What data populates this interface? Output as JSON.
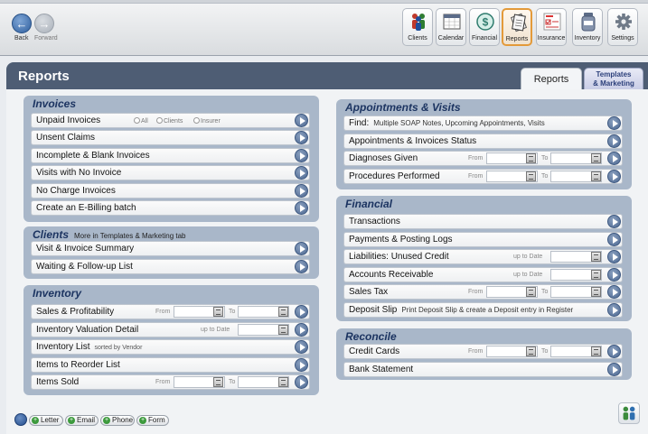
{
  "nav": {
    "back": "Back",
    "forward": "Forward"
  },
  "toolbar": [
    {
      "name": "clients",
      "label": "Clients",
      "icon": "people-icon"
    },
    {
      "name": "calendar",
      "label": "Calendar",
      "icon": "calendar-icon"
    },
    {
      "name": "financial",
      "label": "Financial",
      "icon": "dollar-icon"
    },
    {
      "name": "reports",
      "label": "Reports",
      "icon": "reports-icon",
      "active": true
    },
    {
      "name": "insurance",
      "label": "Insurance",
      "icon": "insurance-form-icon"
    },
    {
      "name": "inventory",
      "label": "Inventory",
      "icon": "inventory-jar-icon"
    },
    {
      "name": "settings",
      "label": "Settings",
      "icon": "gear-icon"
    }
  ],
  "window": {
    "title": "Reports",
    "tabs": {
      "reports": "Reports",
      "templates_line1": "Templates",
      "templates_line2": "& Marketing"
    }
  },
  "labels": {
    "from": "From",
    "to": "To",
    "up_to_date": "up to Date"
  },
  "invoices": {
    "title": "Invoices",
    "unpaid": "Unpaid Invoices",
    "radio_all": "All",
    "radio_clients": "Clients",
    "radio_insurer": "Insurer",
    "unsent": "Unsent Claims",
    "incomplete": "Incomplete & Blank Invoices",
    "visits_no_invoice": "Visits with No Invoice",
    "no_charge": "No Charge Invoices",
    "ebilling": "Create an E-Billing batch"
  },
  "clients": {
    "title": "Clients",
    "note": "More in Templates & Marketing tab",
    "visit_summary": "Visit & Invoice Summary",
    "waiting": "Waiting & Follow-up List"
  },
  "inventory": {
    "title": "Inventory",
    "sales": "Sales & Profitability",
    "valuation": "Inventory Valuation Detail",
    "list": "Inventory List",
    "list_sub": "sorted by Vendor",
    "reorder": "Items to Reorder List",
    "sold": "Items Sold"
  },
  "appointments": {
    "title": "Appointments & Visits",
    "find": "Find:",
    "find_sub": "Multiple SOAP Notes, Upcoming Appointments, Visits",
    "status": "Appointments & Invoices Status",
    "diagnoses": "Diagnoses Given",
    "procedures": "Procedures Performed"
  },
  "financial": {
    "title": "Financial",
    "transactions": "Transactions",
    "payments": "Payments & Posting Logs",
    "liabilities": "Liabilities: Unused Credit",
    "receivable": "Accounts Receivable",
    "sales_tax": "Sales Tax",
    "deposit": "Deposit Slip",
    "deposit_sub": "Print Deposit Slip & create a Deposit entry in Register"
  },
  "reconcile": {
    "title": "Reconcile",
    "credit_cards": "Credit Cards",
    "bank": "Bank Statement"
  },
  "bottom": {
    "letter": "Letter",
    "email": "Email",
    "phone": "Phone",
    "form": "Form"
  }
}
